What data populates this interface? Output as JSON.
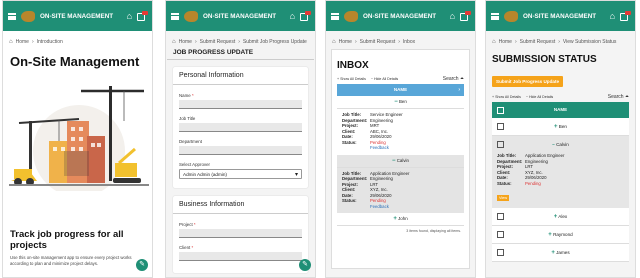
{
  "app": {
    "title": "ON-SITE MANAGEMENT"
  },
  "screen1": {
    "crumb_home": "Home",
    "crumb_current": "Introduction",
    "heading": "On-Site Management",
    "tagline": "Track job progress for all projects",
    "description": "Use this on-site management app to ensure every project works according to plan and minimize project delays."
  },
  "screen2": {
    "crumb_home": "Home",
    "crumb_mid": "Submit Request",
    "crumb_current": "Submit Job Progress Update",
    "section_title": "JOB PROGRESS UPDATE",
    "personal": {
      "title": "Personal Information",
      "name_label": "Name",
      "job_title_label": "Job Title",
      "department_label": "Department",
      "approver_label": "Select Approver",
      "approver_value": "Admin Admin (admin)"
    },
    "business": {
      "title": "Business Information",
      "project_label": "Project",
      "client_label": "Client"
    }
  },
  "screen3": {
    "crumb_home": "Home",
    "crumb_mid": "Submit Request",
    "crumb_current": "Inbox",
    "title": "INBOX",
    "show_all": "Show All Details",
    "hide_all": "Hide All Details",
    "search": "Search",
    "column": "NAME",
    "keys": {
      "job": "Job Title:",
      "dept": "Department:",
      "project": "Project:",
      "client": "Client:",
      "date": "Date:",
      "status": "Status:"
    },
    "rows": [
      {
        "name": "Ben",
        "job": "Service Engineer",
        "dept": "Engineering",
        "project": "MRT",
        "client": "ABC, Inc.",
        "date": "29/06/2020",
        "status": "Pending",
        "feedback": "Feedback"
      },
      {
        "name": "Calvin",
        "job": "Application Engineer",
        "dept": "Engineering",
        "project": "LRT",
        "client": "XYZ, Inc.",
        "date": "29/06/2020",
        "status": "Pending",
        "feedback": "Feedback"
      },
      {
        "name": "John"
      }
    ],
    "footer": "3 items found, displaying all items."
  },
  "screen4": {
    "crumb_home": "Home",
    "crumb_mid": "Submit Request",
    "crumb_current": "View Submission Status",
    "title": "SUBMISSION STATUS",
    "submit_button": "Submit Job Progress Update",
    "show_all": "Show All Details",
    "hide_all": "Hide All Details",
    "search": "Search",
    "column": "NAME",
    "keys": {
      "job": "Job Title:",
      "dept": "Department:",
      "project": "Project:",
      "client": "Client:",
      "date": "Date:",
      "status": "Status:"
    },
    "rows": [
      {
        "name": "Ben"
      },
      {
        "name": "Calvin",
        "job": "Application Engineer",
        "dept": "Engineering",
        "project": "LRT",
        "client": "XYZ, Inc.",
        "date": "29/06/2020",
        "status": "Pending",
        "view": "View"
      },
      {
        "name": "Alex"
      },
      {
        "name": "Raymond"
      },
      {
        "name": "James"
      }
    ]
  },
  "colors": {
    "primary": "#1f8f76",
    "accent": "#f5a31a",
    "table_header": "#58a6d8",
    "pending": "#dd3333"
  }
}
